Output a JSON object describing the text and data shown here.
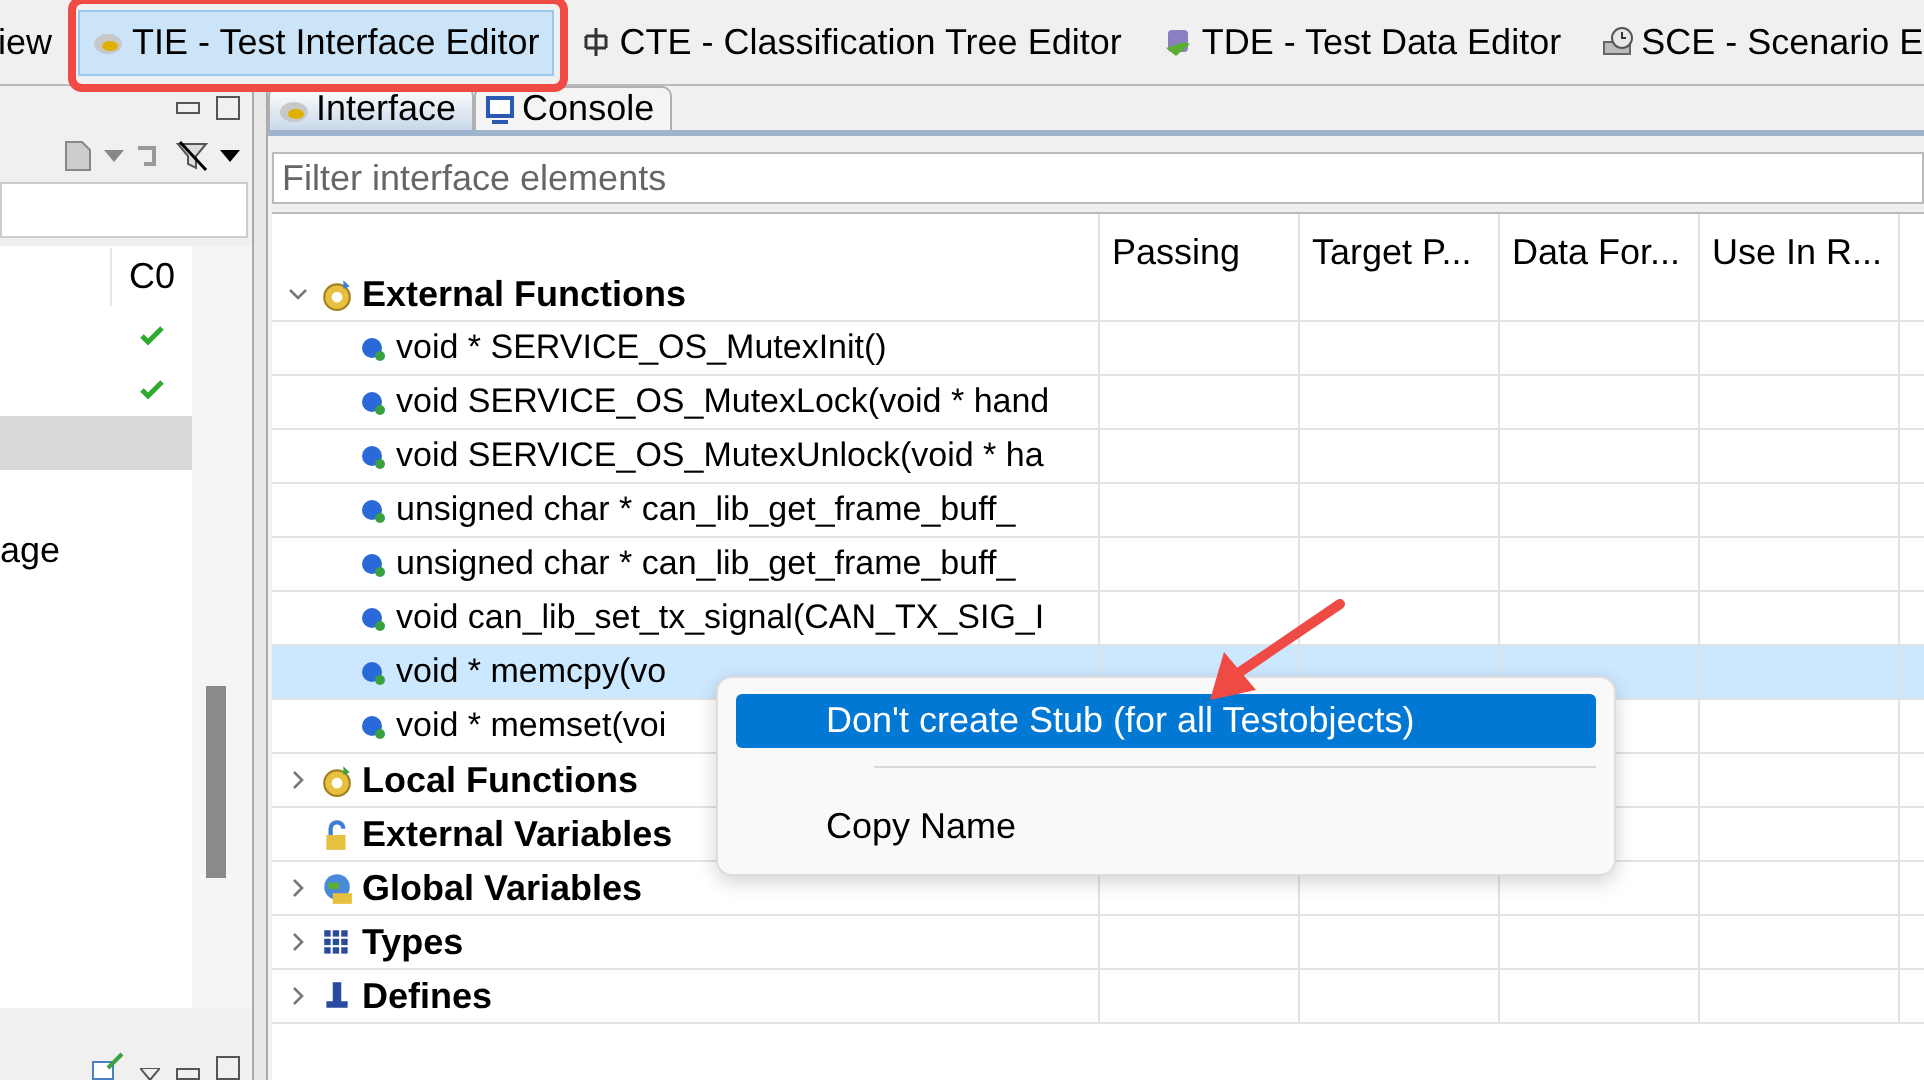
{
  "perspectives": [
    {
      "label": "iew",
      "selected": false,
      "annotated": false
    },
    {
      "label": "TIE - Test Interface Editor",
      "selected": true,
      "annotated": true
    },
    {
      "label": "CTE - Classification Tree Editor",
      "selected": false,
      "annotated": false
    },
    {
      "label": "TDE - Test Data Editor",
      "selected": false,
      "annotated": false
    },
    {
      "label": "SCE - Scenario E",
      "selected": false,
      "annotated": false
    }
  ],
  "left_panel": {
    "columns": [
      "C0"
    ],
    "rows": [
      {
        "passed": true,
        "selected": false,
        "text": null
      },
      {
        "passed": true,
        "selected": false,
        "text": null
      },
      {
        "passed": false,
        "selected": true,
        "text": null
      },
      {
        "passed": false,
        "selected": false,
        "text": null
      },
      {
        "passed": false,
        "selected": false,
        "text": "age"
      }
    ]
  },
  "tabs": [
    {
      "label": "Interface",
      "selected": true
    },
    {
      "label": "Console",
      "selected": false
    }
  ],
  "filter": {
    "placeholder": "Filter interface elements"
  },
  "tree": {
    "columns": [
      "Passing",
      "Target P...",
      "Data For...",
      "Use In R..."
    ],
    "items": [
      {
        "label": "External Functions",
        "expandable": true,
        "expanded": true,
        "children": [
          {
            "label": "void * SERVICE_OS_MutexInit()",
            "selected": false
          },
          {
            "label": "void SERVICE_OS_MutexLock(void * hand",
            "selected": false
          },
          {
            "label": "void SERVICE_OS_MutexUnlock(void * ha",
            "selected": false
          },
          {
            "label": "unsigned char * can_lib_get_frame_buff_",
            "selected": false
          },
          {
            "label": "unsigned char * can_lib_get_frame_buff_",
            "selected": false
          },
          {
            "label": "void can_lib_set_tx_signal(CAN_TX_SIG_I",
            "selected": false
          },
          {
            "label": "void * memcpy(vo",
            "selected": true
          },
          {
            "label": "void * memset(voi",
            "selected": false
          }
        ]
      },
      {
        "label": "Local Functions",
        "expandable": true,
        "expanded": false
      },
      {
        "label": "External Variables",
        "expandable": false,
        "expanded": false
      },
      {
        "label": "Global Variables",
        "expandable": true,
        "expanded": false
      },
      {
        "label": "Types",
        "expandable": true,
        "expanded": false
      },
      {
        "label": "Defines",
        "expandable": true,
        "expanded": false
      }
    ]
  },
  "context_menu": {
    "items": [
      {
        "kind": "item",
        "label": "Don't create Stub (for all Testobjects)",
        "selected": true
      },
      {
        "kind": "separator"
      },
      {
        "kind": "item",
        "label": "Copy Name",
        "selected": false
      }
    ]
  }
}
